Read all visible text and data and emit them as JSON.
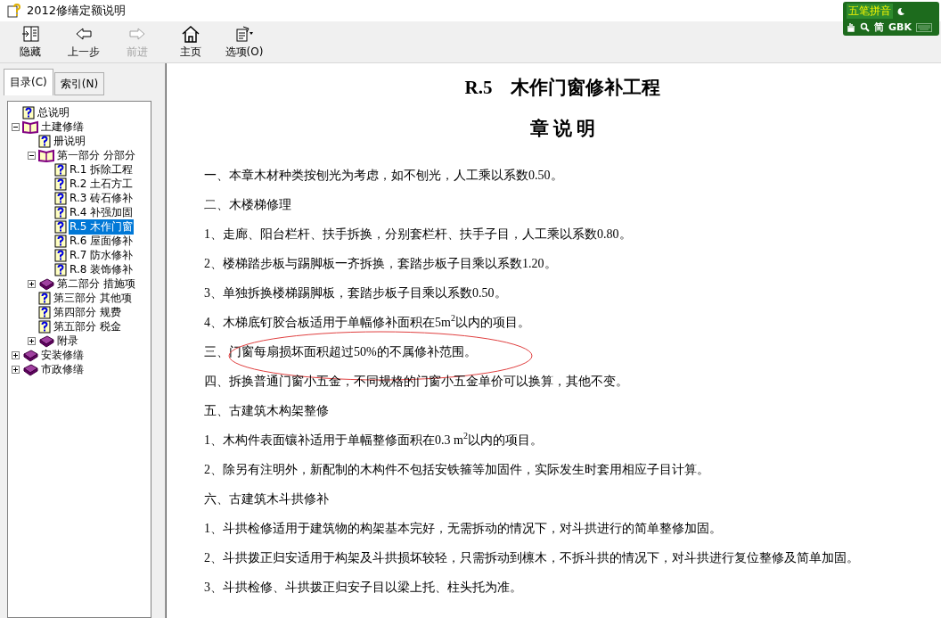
{
  "window": {
    "title": "2012修缮定额说明"
  },
  "ime": {
    "mode": "五笔拼音",
    "charset": "简",
    "encoding": "GBK"
  },
  "toolbar": [
    {
      "label": "隐藏",
      "kind": "hide",
      "disabled": false
    },
    {
      "label": "上一步",
      "kind": "back",
      "disabled": false
    },
    {
      "label": "前进",
      "kind": "forward",
      "disabled": true
    },
    {
      "label": "主页",
      "kind": "home",
      "disabled": false
    },
    {
      "label": "选项(O)",
      "kind": "options",
      "disabled": false
    }
  ],
  "tabs": [
    {
      "label": "目录(C)",
      "selected": true
    },
    {
      "label": "索引(N)",
      "selected": false
    }
  ],
  "tree": [
    {
      "label": "总说明",
      "kind": "page",
      "selected": false
    },
    {
      "label": "土建修缮",
      "kind": "book",
      "expanded": true,
      "selected": false,
      "children": [
        {
          "label": "册说明",
          "kind": "page",
          "selected": false
        },
        {
          "label": "第一部分 分部分",
          "kind": "book",
          "expanded": true,
          "selected": false,
          "children": [
            {
              "label": "R.1 拆除工程",
              "kind": "page",
              "selected": false
            },
            {
              "label": "R.2 土石方工",
              "kind": "page",
              "selected": false
            },
            {
              "label": "R.3 砖石修补",
              "kind": "page",
              "selected": false
            },
            {
              "label": "R.4 补强加固",
              "kind": "page",
              "selected": false
            },
            {
              "label": "R.5 木作门窗",
              "kind": "page",
              "selected": true
            },
            {
              "label": "R.6 屋面修补",
              "kind": "page",
              "selected": false
            },
            {
              "label": "R.7 防水修补",
              "kind": "page",
              "selected": false
            },
            {
              "label": "R.8 装饰修补",
              "kind": "page",
              "selected": false
            }
          ]
        },
        {
          "label": "第二部分 措施项",
          "kind": "book",
          "expanded": false,
          "selected": false
        },
        {
          "label": "第三部分 其他项",
          "kind": "page",
          "selected": false
        },
        {
          "label": "第四部分 规费",
          "kind": "page",
          "selected": false
        },
        {
          "label": "第五部分 税金",
          "kind": "page",
          "selected": false
        },
        {
          "label": "附录",
          "kind": "book",
          "expanded": false,
          "selected": false
        }
      ]
    },
    {
      "label": "安装修缮",
      "kind": "book",
      "expanded": false,
      "selected": false
    },
    {
      "label": "市政修缮",
      "kind": "book",
      "expanded": false,
      "selected": false
    }
  ],
  "document": {
    "title": "R.5　木作门窗修补工程",
    "subtitle": "章 说 明",
    "paragraphs": [
      {
        "text": "一、本章木材种类按刨光为考虑，如不刨光，人工乘以系数0.50。",
        "circled": false
      },
      {
        "text": "二、木楼梯修理",
        "circled": false
      },
      {
        "text": "1、走廊、阳台栏杆、扶手拆换，分别套栏杆、扶手子目，人工乘以系数0.80。",
        "circled": false
      },
      {
        "text": "2、楼梯踏步板与踢脚板一齐拆换，套踏步板子目乘以系数1.20。",
        "circled": false
      },
      {
        "text": "3、单独拆换楼梯踢脚板，套踏步板子目乘以系数0.50。",
        "circled": false
      },
      {
        "text": "4、木梯底钉胶合板适用于单幅修补面积在5m$^{2}$以内的项目。",
        "circled": false
      },
      {
        "text": "三、门窗每扇损坏面积超过50%的不属修补范围。",
        "circled": true
      },
      {
        "text": "四、拆换普通门窗小五金，不同规格的门窗小五金单价可以换算，其他不变。",
        "circled": false
      },
      {
        "text": "五、古建筑木构架整修",
        "circled": false
      },
      {
        "text": "1、木构件表面镶补适用于单幅整修面积在0.3 m$^{2}$以内的项目。",
        "circled": false
      },
      {
        "text": "2、除另有注明外，新配制的木构件不包括安铁箍等加固件，实际发生时套用相应子目计算。",
        "circled": false
      },
      {
        "text": "六、古建筑木斗拱修补",
        "circled": false
      },
      {
        "text": "1、斗拱检修适用于建筑物的构架基本完好，无需拆动的情况下，对斗拱进行的简单整修加固。",
        "circled": false
      },
      {
        "text": "2、斗拱拨正归安适用于构架及斗拱损坏较轻，只需拆动到檩木，不拆斗拱的情况下，对斗拱进行复位整修及简单加固。",
        "circled": false
      },
      {
        "text": "3、斗拱检修、斗拱拨正归安子目以梁上托、柱头托为准。",
        "circled": false
      }
    ]
  }
}
